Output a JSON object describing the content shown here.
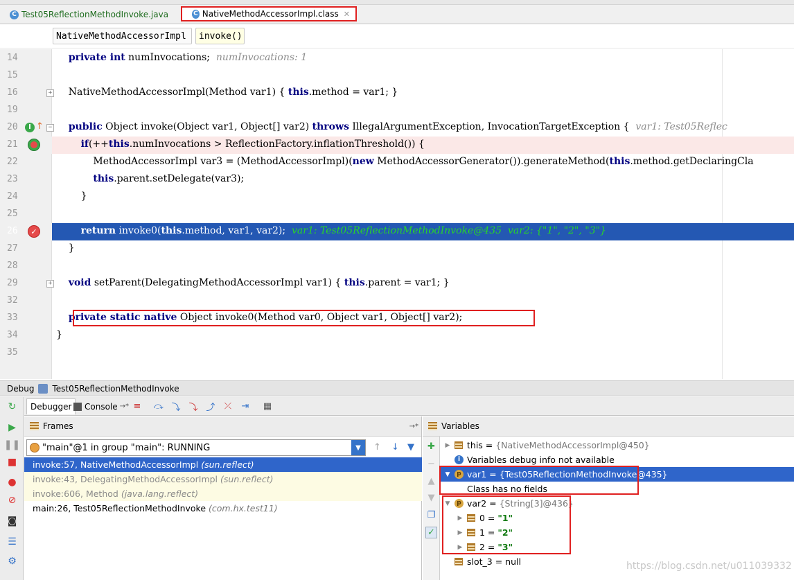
{
  "tabs": [
    {
      "label": "Test05ReflectionMethodInvoke.java",
      "icon": "java-class-icon"
    },
    {
      "label": "NativeMethodAccessorImpl.class",
      "icon": "class-file-icon"
    }
  ],
  "breadcrumb": {
    "class": "NativeMethodAccessorImpl",
    "method": "invoke()"
  },
  "editor": {
    "lines": [
      {
        "num": "14",
        "parts": [
          [
            "",
            "    "
          ],
          [
            "kw",
            "private int"
          ],
          [
            "",
            " numInvocations;  "
          ],
          [
            "hint",
            "numInvocations: 1"
          ]
        ]
      },
      {
        "num": "15",
        "parts": []
      },
      {
        "num": "16",
        "parts": [
          [
            "",
            "    NativeMethodAccessorImpl(Method var1) { "
          ],
          [
            "kw",
            "this"
          ],
          [
            "",
            ".method = var1; }"
          ]
        ]
      },
      {
        "num": "19",
        "parts": []
      },
      {
        "num": "20",
        "parts": [
          [
            "",
            "    "
          ],
          [
            "kw",
            "public"
          ],
          [
            "",
            " Object invoke(Object var1, Object[] var2) "
          ],
          [
            "kw",
            "throws"
          ],
          [
            "",
            " IllegalArgumentException, InvocationTargetException {  "
          ],
          [
            "hint",
            "var1: Test05Reflec"
          ]
        ]
      },
      {
        "num": "21",
        "parts": [
          [
            "",
            "        "
          ],
          [
            "kw",
            "if"
          ],
          [
            "",
            "(++"
          ],
          [
            "kw",
            "this"
          ],
          [
            "",
            ".numInvocations > ReflectionFactory.inflationThreshold()) {"
          ]
        ]
      },
      {
        "num": "22",
        "parts": [
          [
            "",
            "            MethodAccessorImpl var3 = (MethodAccessorImpl)("
          ],
          [
            "kw",
            "new"
          ],
          [
            "",
            " MethodAccessorGenerator()).generateMethod("
          ],
          [
            "kw",
            "this"
          ],
          [
            "",
            ".method.getDeclaringCla"
          ]
        ]
      },
      {
        "num": "23",
        "parts": [
          [
            "",
            "            "
          ],
          [
            "kw",
            "this"
          ],
          [
            "",
            ".parent.setDelegate(var3);"
          ]
        ]
      },
      {
        "num": "24",
        "parts": [
          [
            "",
            "        }"
          ]
        ]
      },
      {
        "num": "25",
        "parts": []
      },
      {
        "num": "26",
        "parts": [
          [
            "",
            "        "
          ],
          [
            "kw",
            "return"
          ],
          [
            "",
            " invoke0("
          ],
          [
            "kw",
            "this"
          ],
          [
            "",
            ".method, var1, var2);  "
          ],
          [
            "hint-green",
            "var1: Test05ReflectionMethodInvoke@435  var2: {\"1\", \"2\", \"3\"}"
          ]
        ]
      },
      {
        "num": "27",
        "parts": [
          [
            "",
            "    }"
          ]
        ]
      },
      {
        "num": "28",
        "parts": []
      },
      {
        "num": "29",
        "parts": [
          [
            "",
            "    "
          ],
          [
            "kw",
            "void"
          ],
          [
            "",
            " setParent(DelegatingMethodAccessorImpl var1) { "
          ],
          [
            "kw",
            "this"
          ],
          [
            "",
            ".parent = var1; }"
          ]
        ]
      },
      {
        "num": "32",
        "parts": []
      },
      {
        "num": "33",
        "parts": [
          [
            "",
            "    "
          ],
          [
            "kw",
            "private static native"
          ],
          [
            "",
            " Object invoke0(Method var0, Object var1, Object[] var2);"
          ]
        ]
      },
      {
        "num": "34",
        "parts": [
          [
            "",
            "}"
          ]
        ]
      },
      {
        "num": "35",
        "parts": []
      }
    ]
  },
  "debug": {
    "title_prefix": "Debug",
    "run_config": "Test05ReflectionMethodInvoke",
    "tab_debugger": "Debugger",
    "tab_console": "Console",
    "console_suffix": "→*"
  },
  "frames": {
    "header": "Frames",
    "pin": "→*",
    "thread": "\"main\"@1 in group \"main\": RUNNING",
    "rows": [
      {
        "method": "invoke:57, NativeMethodAccessorImpl",
        "pkg": "(sun.reflect)",
        "style": "sel"
      },
      {
        "method": "invoke:43, DelegatingMethodAccessorImpl",
        "pkg": "(sun.reflect)",
        "style": "lib"
      },
      {
        "method": "invoke:606, Method",
        "pkg": "(java.lang.reflect)",
        "style": "lib"
      },
      {
        "method": "main:26, Test05ReflectionMethodInvoke",
        "pkg": "(com.hx.test11)",
        "style": "normal"
      }
    ]
  },
  "variables": {
    "header": "Variables",
    "rows": [
      {
        "indent": 0,
        "tri": "▶",
        "icon": "list",
        "name": "this",
        "eq": " = ",
        "value": "{NativeMethodAccessorImpl@450}",
        "valueStyle": "gray"
      },
      {
        "indent": 0,
        "tri": "",
        "icon": "info",
        "name": "Variables debug info not available",
        "eq": "",
        "value": "",
        "valueStyle": ""
      },
      {
        "indent": 0,
        "tri": "▼",
        "icon": "p",
        "name": "var1",
        "eq": " = ",
        "value": "{Test05ReflectionMethodInvoke@435}",
        "valueStyle": "gray",
        "selected": true
      },
      {
        "indent": 1,
        "tri": "",
        "icon": "",
        "name": "Class has no fields",
        "eq": "",
        "value": "",
        "valueStyle": ""
      },
      {
        "indent": 0,
        "tri": "▼",
        "icon": "p",
        "name": "var2",
        "eq": " = ",
        "value": "{String[3]@436}",
        "valueStyle": "gray"
      },
      {
        "indent": 1,
        "tri": "▶",
        "icon": "list",
        "name": "0",
        "eq": " = ",
        "value": "\"1\"",
        "valueStyle": "str"
      },
      {
        "indent": 1,
        "tri": "▶",
        "icon": "list",
        "name": "1",
        "eq": " = ",
        "value": "\"2\"",
        "valueStyle": "str"
      },
      {
        "indent": 1,
        "tri": "▶",
        "icon": "list",
        "name": "2",
        "eq": " = ",
        "value": "\"3\"",
        "valueStyle": "str"
      },
      {
        "indent": 0,
        "tri": "",
        "icon": "list",
        "name": "slot_3",
        "eq": " = ",
        "value": "null",
        "valueStyle": ""
      }
    ]
  },
  "watermark": "https://blog.csdn.net/u011039332",
  "colors": {
    "selection": "#2f65ca",
    "breakpoint_line": "#2458b3",
    "red_box": "#e02020",
    "keyword": "#000080",
    "string": "#117a11"
  }
}
